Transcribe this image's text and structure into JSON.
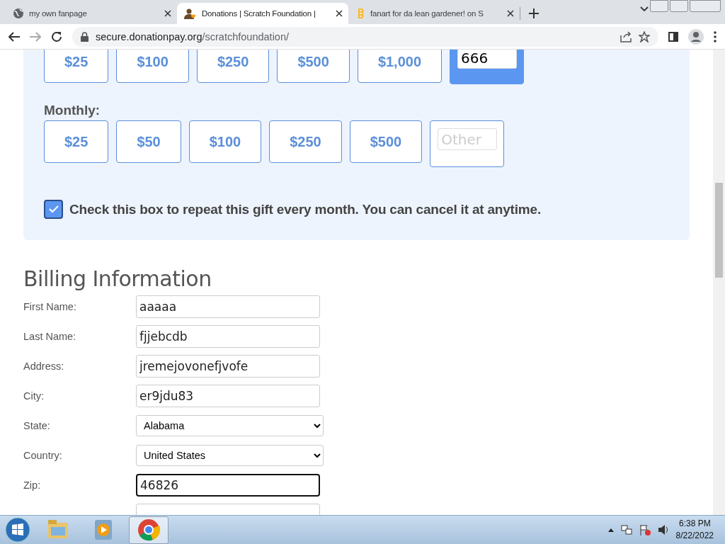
{
  "browser": {
    "tabs": [
      {
        "title": "my own fanpage",
        "selected": false
      },
      {
        "title": "Donations | Scratch Foundation |",
        "selected": true
      },
      {
        "title": "fanart for da lean gardener! on S",
        "selected": false
      }
    ],
    "address": {
      "host": "secure.donationpay.org",
      "path": "/scratchfoundation/"
    }
  },
  "donation": {
    "one_time": [
      {
        "label": "$25",
        "selected": false
      },
      {
        "label": "$100",
        "selected": false
      },
      {
        "label": "$250",
        "selected": false
      },
      {
        "label": "$500",
        "selected": false
      },
      {
        "label": "$1,000",
        "selected": false
      },
      {
        "kind": "other",
        "value": "666",
        "selected": true
      }
    ],
    "monthly_label": "Monthly:",
    "monthly": [
      {
        "label": "$25",
        "selected": false
      },
      {
        "label": "$50",
        "selected": false
      },
      {
        "label": "$100",
        "selected": false
      },
      {
        "label": "$250",
        "selected": false
      },
      {
        "label": "$500",
        "selected": false
      },
      {
        "kind": "other",
        "placeholder": "Other",
        "selected": false
      }
    ],
    "repeat": {
      "label": "Check this box to repeat this gift every month. You can cancel it at anytime.",
      "checked": true
    }
  },
  "billing": {
    "title": "Billing Information",
    "fields": [
      {
        "label": "First Name:",
        "kind": "text",
        "value": "aaaaa",
        "focused": false
      },
      {
        "label": "Last Name:",
        "kind": "text",
        "value": "fjjebcdb",
        "focused": false
      },
      {
        "label": "Address:",
        "kind": "text",
        "value": "jremejovonefjvofe",
        "focused": false
      },
      {
        "label": "City:",
        "kind": "text",
        "value": "er9jdu83",
        "focused": false
      },
      {
        "label": "State:",
        "kind": "select",
        "value": "Alabama",
        "focused": false
      },
      {
        "label": "Country:",
        "kind": "select",
        "value": "United States",
        "focused": false
      },
      {
        "label": "Zip:",
        "kind": "text",
        "value": "46826",
        "focused": true
      },
      {
        "kind": "text",
        "focused": false
      }
    ]
  },
  "taskbar": {
    "apps": [
      {
        "selected": false
      },
      {
        "selected": false
      },
      {
        "selected": true
      }
    ],
    "time": "6:38 PM",
    "date": "8/22/2022"
  }
}
